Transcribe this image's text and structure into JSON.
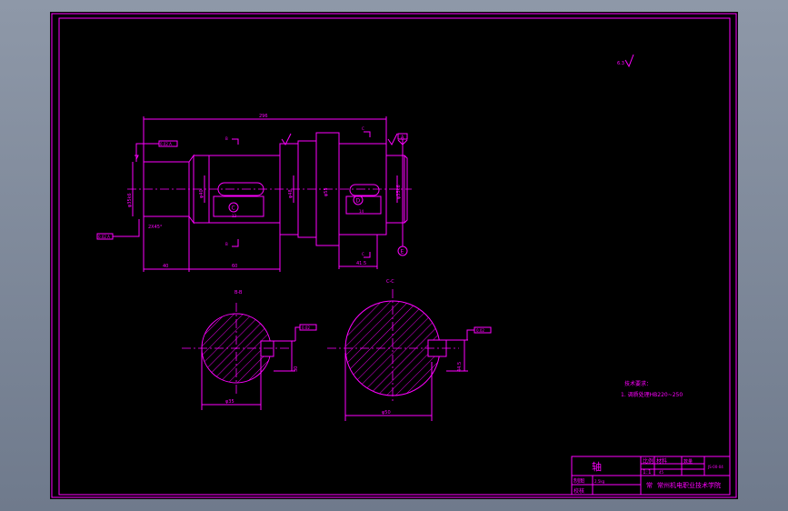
{
  "drawing": {
    "title_block": {
      "part_name": "轴",
      "scale_label": "比例",
      "material_label": "材料",
      "quantity_label": "数量",
      "scale_value": "1:1",
      "material_value": "45",
      "drawing_number": "JS-00-04",
      "drawn_by_label": "制图",
      "checked_by_label": "校核",
      "weight_value": "2.5kg",
      "school": "常州机电职业技术学院",
      "school_prefix": "常"
    },
    "roughness_symbol": "6.3",
    "technical_requirements": {
      "heading": "技术要求：",
      "item_1": "1. 调质处理HB220~250"
    },
    "section_labels": {
      "b_section": "B-B",
      "c_section": "C-C",
      "b_marker_top": "B",
      "b_marker_bottom": "B",
      "c_marker_top": "C",
      "c_marker_bottom": "C"
    },
    "dimensions": {
      "overall_length": "296",
      "dim_40": "40",
      "dim_60": "60",
      "dim_41_5": "41.5",
      "d_left": "φ35k6",
      "d_neck": "φ40",
      "d_mid": "φ48",
      "d_collar": "φ55",
      "d_right": "φ35k6",
      "chamfer": "2X45°",
      "keyway_left": "12",
      "keyway_right": "14",
      "sec_b_width": "φ35",
      "sec_b_depth": "30",
      "sec_c_width": "φ50",
      "sec_c_depth": "44.5"
    },
    "tolerance_frames": {
      "tf_left": "0.02 A",
      "tf_bottom": "0.02 A",
      "tf_sec_b": "0.02",
      "tf_sec_c": "0.02"
    },
    "datum": "A",
    "circle_markers": [
      "C",
      "D",
      "E"
    ]
  }
}
